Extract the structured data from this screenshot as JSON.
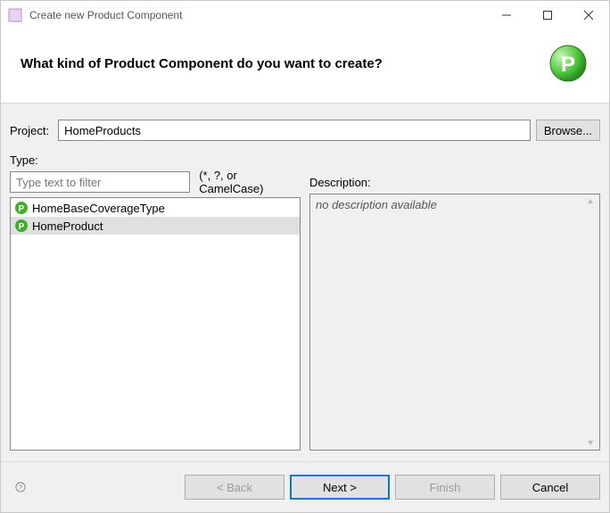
{
  "window": {
    "title": "Create new Product Component"
  },
  "header": {
    "question": "What kind of Product Component do you want to create?"
  },
  "project": {
    "label": "Project:",
    "value": "HomeProducts",
    "browse_label": "Browse..."
  },
  "type": {
    "label": "Type:",
    "filter_placeholder": "Type text to filter",
    "filter_hint": "(*, ?, or CamelCase)",
    "description_label": "Description:",
    "description_text": "no description available",
    "items": [
      {
        "label": "HomeBaseCoverageType",
        "selected": false
      },
      {
        "label": "HomeProduct",
        "selected": true
      }
    ]
  },
  "buttons": {
    "back": "< Back",
    "next": "Next >",
    "finish": "Finish",
    "cancel": "Cancel"
  }
}
